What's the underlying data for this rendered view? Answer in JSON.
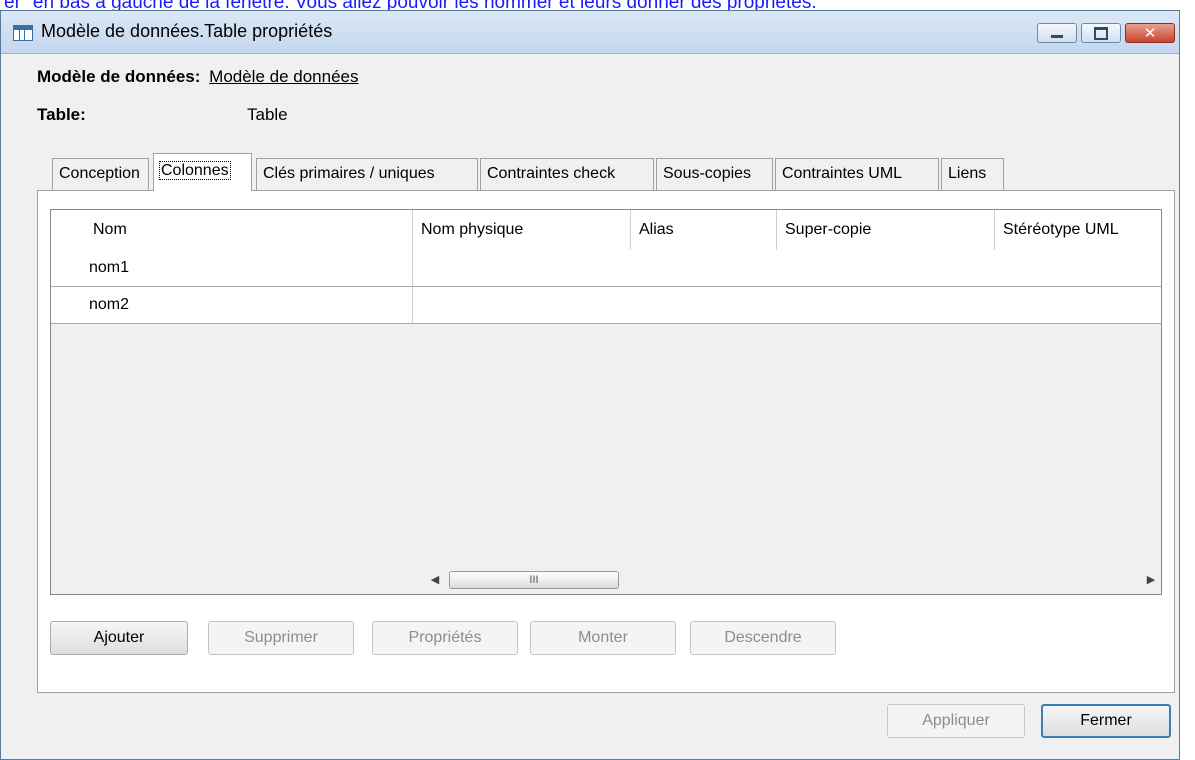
{
  "top_strip": "er\" en bas à gauche de la fenêtre. Vous allez pouvoir les nommer et leurs donner des propriétés.",
  "window": {
    "title": "Modèle de données.Table propriétés",
    "controls": {
      "minimize": "minimize-icon",
      "maximize": "maximize-icon",
      "close": "close-icon"
    }
  },
  "fields": {
    "model_label": "Modèle de données:",
    "model_value": "Modèle de données",
    "table_label": "Table:",
    "table_value": "Table"
  },
  "tabs": [
    {
      "label": "Conception"
    },
    {
      "label": "Colonnes",
      "active": true
    },
    {
      "label": "Clés primaires / uniques"
    },
    {
      "label": "Contraintes check"
    },
    {
      "label": "Sous-copies"
    },
    {
      "label": "Contraintes UML"
    },
    {
      "label": "Liens"
    }
  ],
  "grid": {
    "columns": [
      "Nom",
      "Nom physique",
      "Alias",
      "Super-copie",
      "Stéréotype UML"
    ],
    "rows": [
      [
        "nom1",
        "",
        "",
        "",
        ""
      ],
      [
        "nom2",
        "",
        "",
        "",
        ""
      ]
    ],
    "scroll_thumb": "III"
  },
  "panel_buttons": {
    "add": "Ajouter",
    "delete": "Supprimer",
    "properties": "Propriétés",
    "up": "Monter",
    "down": "Descendre"
  },
  "footer_buttons": {
    "apply": "Appliquer",
    "close": "Fermer"
  }
}
